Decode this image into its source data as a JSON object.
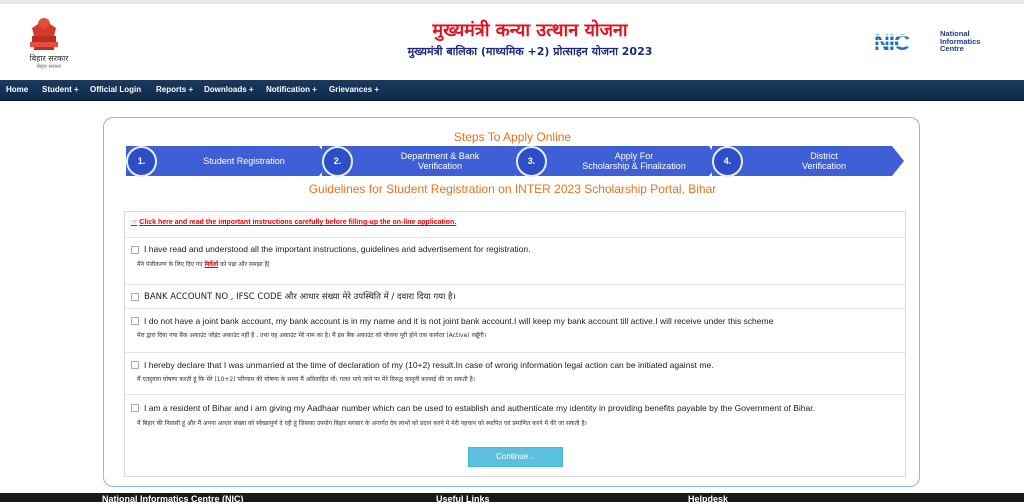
{
  "header": {
    "state_text": "बिहार सरकार",
    "state_sub": "बिहार सरकार",
    "title_main": "मुख्यमंत्री कन्या उत्थान योजना",
    "title_sub": "मुख्यमंत्री बालिका (माध्यमिक +2) प्रोत्साहन योजना 2023",
    "nic_logo_text": "NIC",
    "nic_name_line1": "National",
    "nic_name_line2": "Informatics",
    "nic_name_line3": "Centre"
  },
  "nav": {
    "items": [
      {
        "label": "Home"
      },
      {
        "label": "Student +"
      },
      {
        "label": "Official Login"
      },
      {
        "label": "Reports +"
      },
      {
        "label": "Downloads +"
      },
      {
        "label": "Notification +"
      },
      {
        "label": "Grievances +"
      }
    ]
  },
  "steps": {
    "title": "Steps To Apply Online",
    "items": [
      {
        "num": "1.",
        "line1": "Student Registration",
        "line2": ""
      },
      {
        "num": "2.",
        "line1": "Department & Bank",
        "line2": "Verification"
      },
      {
        "num": "3.",
        "line1": "Apply For",
        "line2": "Scholarship & Finalization"
      },
      {
        "num": "4.",
        "line1": "District",
        "line2": "Verification"
      }
    ]
  },
  "guidelines_title": "Guidelines for Student Registration on INTER 2023 Scholarship Portal, Bihar",
  "instruction_link": "Click here and read the important instructions carefully before filling-up the on-line application.",
  "declarations": [
    {
      "en": "I have read and understood all the important instructions, guidelines and advertisement for registration.",
      "hi_pre": "मैंने पंजीकरण के लिए दिए गए ",
      "hi_link": "निर्देशों",
      "hi_post": " को पढ़ा और समझा है|"
    },
    {
      "en": "BANK ACCOUNT NO , IFSC CODE और आधार संख्या मेरे उपस्थिति में / दवारा दिया गया है।",
      "hi_pre": "",
      "hi_link": "",
      "hi_post": ""
    },
    {
      "en": "I do not have a joint bank account, my bank account is in my name and it is not joint bank account.I will keep my bank account till active.I will receive under this scheme",
      "hi_pre": "मेरा द्वारा दिया गया बैंक अकाउंट जॉइंट अकाउंट नहीं है , तथा यह अकाउंट मेरे नाम का है। मैं इस बैंक अकाउंट को योजना पूरी होने तक कार्यरत (Active) रखूँगी।",
      "hi_link": "",
      "hi_post": ""
    },
    {
      "en": "I hereby declare that I was unmarried at the time of declaration of my (10+2) result.In case of wrong information legal action can be initiated against me.",
      "hi_pre": "मैं एतद्द्वारा घोषणा करती हूं कि मेरे (10+2) परिणाम की घोषणा के समय मैं अविवाहित थी। गलत पाये जाने पर मेरे विरुद्ध कानूनी करवाई की जा सकती है।",
      "hi_link": "",
      "hi_post": ""
    },
    {
      "en": "I am a resident of Bihar and i am giving my Aadhaar number which can be used to establish and authenticate my identity in providing benefits payable by the Government of Bihar.",
      "hi_pre": "मैं बिहार की निवासी हूं और मैं अपना आधार संख्या को स्वेच्छापूर्ण दे रही हूं जिसका उपयोग बिहार सरकार के अन्तर्गत देय लाभों को प्रदान करने में मेरी पहचान को स्थापित एवं प्रमाणित करने में की जा सकती है।",
      "hi_link": "",
      "hi_post": ""
    }
  ],
  "continue_label": "Continue ..",
  "footer": {
    "col1": "National Informatics Centre (NIC)",
    "col2": "Useful Links",
    "col3": "Helpdesk"
  },
  "colors": {
    "accent_orange": "#e7711b",
    "step_blue": "#3e5fd5",
    "title_red": "#e0141e",
    "title_navy": "#1c2a7a",
    "nav_bg": "#1a3a60",
    "button_cyan": "#5bc0de"
  }
}
